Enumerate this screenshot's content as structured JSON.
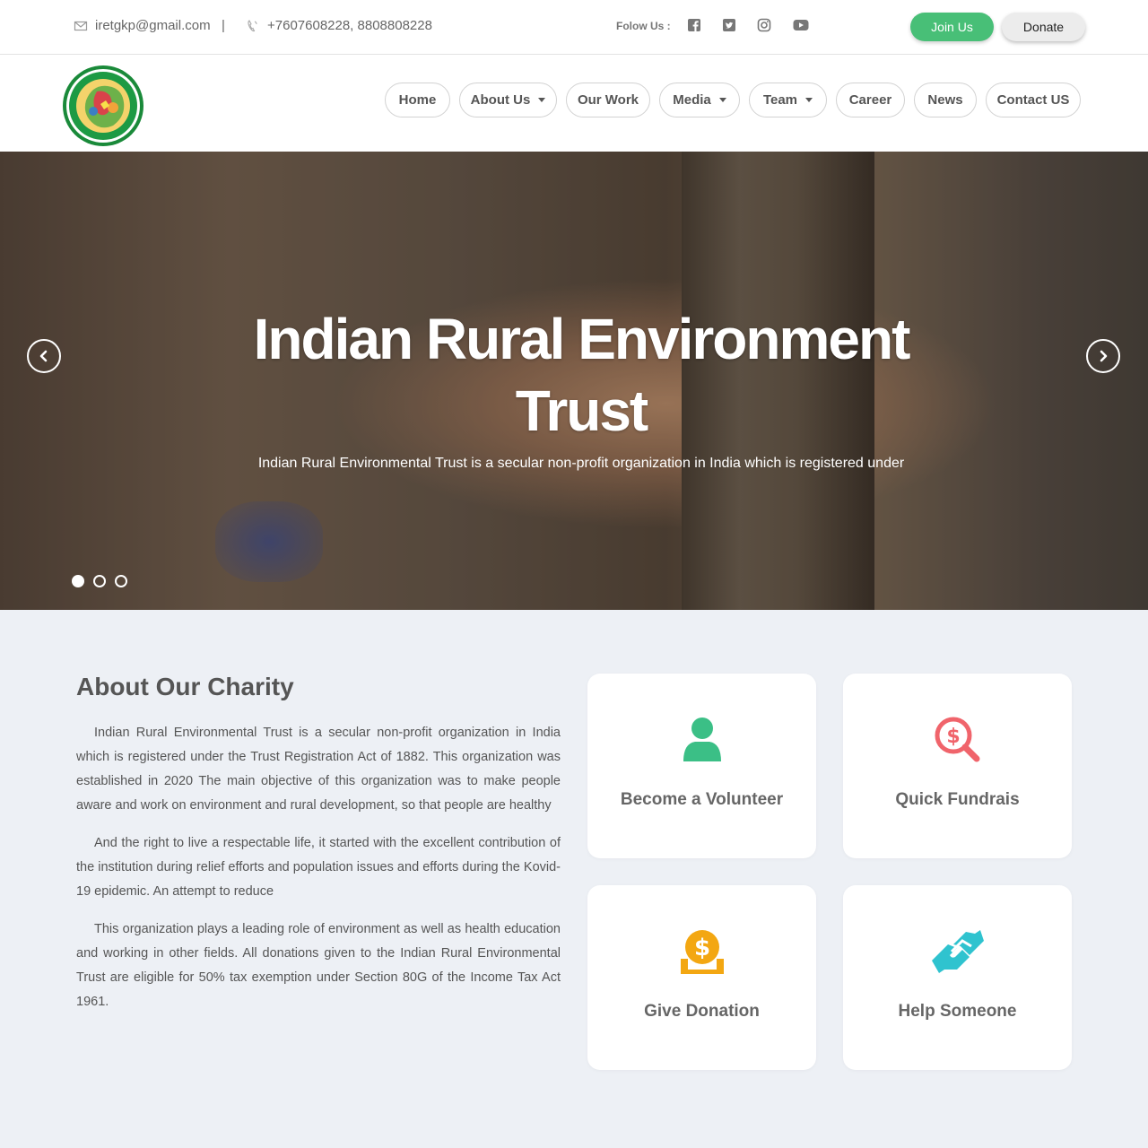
{
  "topbar": {
    "email": "iretgkp@gmail.com",
    "separator": "|",
    "phone": "+7607608228, 8808808228",
    "follow_label": "Folow Us :",
    "social": [
      "facebook-icon",
      "twitter-icon",
      "instagram-icon",
      "youtube-icon"
    ],
    "join_label": "Join Us",
    "donate_label": "Donate"
  },
  "nav": {
    "items": [
      {
        "label": "Home"
      },
      {
        "label": "About Us"
      },
      {
        "label": "Our Work"
      },
      {
        "label": "Media"
      },
      {
        "label": "Team"
      },
      {
        "label": "Career"
      },
      {
        "label": "News"
      },
      {
        "label": "Contact US"
      }
    ]
  },
  "hero": {
    "title_line1": "Indian Rural Environment",
    "title_line2": "Trust",
    "subtitle": "Indian Rural Environmental Trust is a secular non-profit organization in India which is registered under",
    "slides": 3,
    "active_slide": 1
  },
  "about": {
    "title": "About Our Charity",
    "paragraphs": [
      "Indian Rural Environmental Trust is a secular non-profit organization in India which is registered under the Trust Registration Act of 1882. This organization was established in 2020 The main objective of this organization was to make people aware and work on environment and rural development, so that people are healthy",
      "And the right to live a respectable life, it started with the excellent contribution of the institution during relief efforts and population issues and efforts during the Kovid-19 epidemic. An attempt to reduce",
      "This organization plays a leading role of environment as well as health education and working in other fields. All donations given to the Indian Rural Environmental Trust are eligible for 50% tax exemption under Section 80G of the Income Tax Act 1961."
    ]
  },
  "cards": [
    {
      "label": "Become a Volunteer",
      "icon": "person-icon",
      "color": "#3bbf86"
    },
    {
      "label": "Quick Fundrais",
      "icon": "money-search-icon",
      "color": "#f0646b"
    },
    {
      "label": "Give Donation",
      "icon": "donation-coin-icon",
      "color": "#f3a712"
    },
    {
      "label": "Help Someone",
      "icon": "handshake-icon",
      "color": "#2fc3cf"
    }
  ],
  "colors": {
    "join_button": "#48bf77",
    "background": "#edf0f5"
  }
}
